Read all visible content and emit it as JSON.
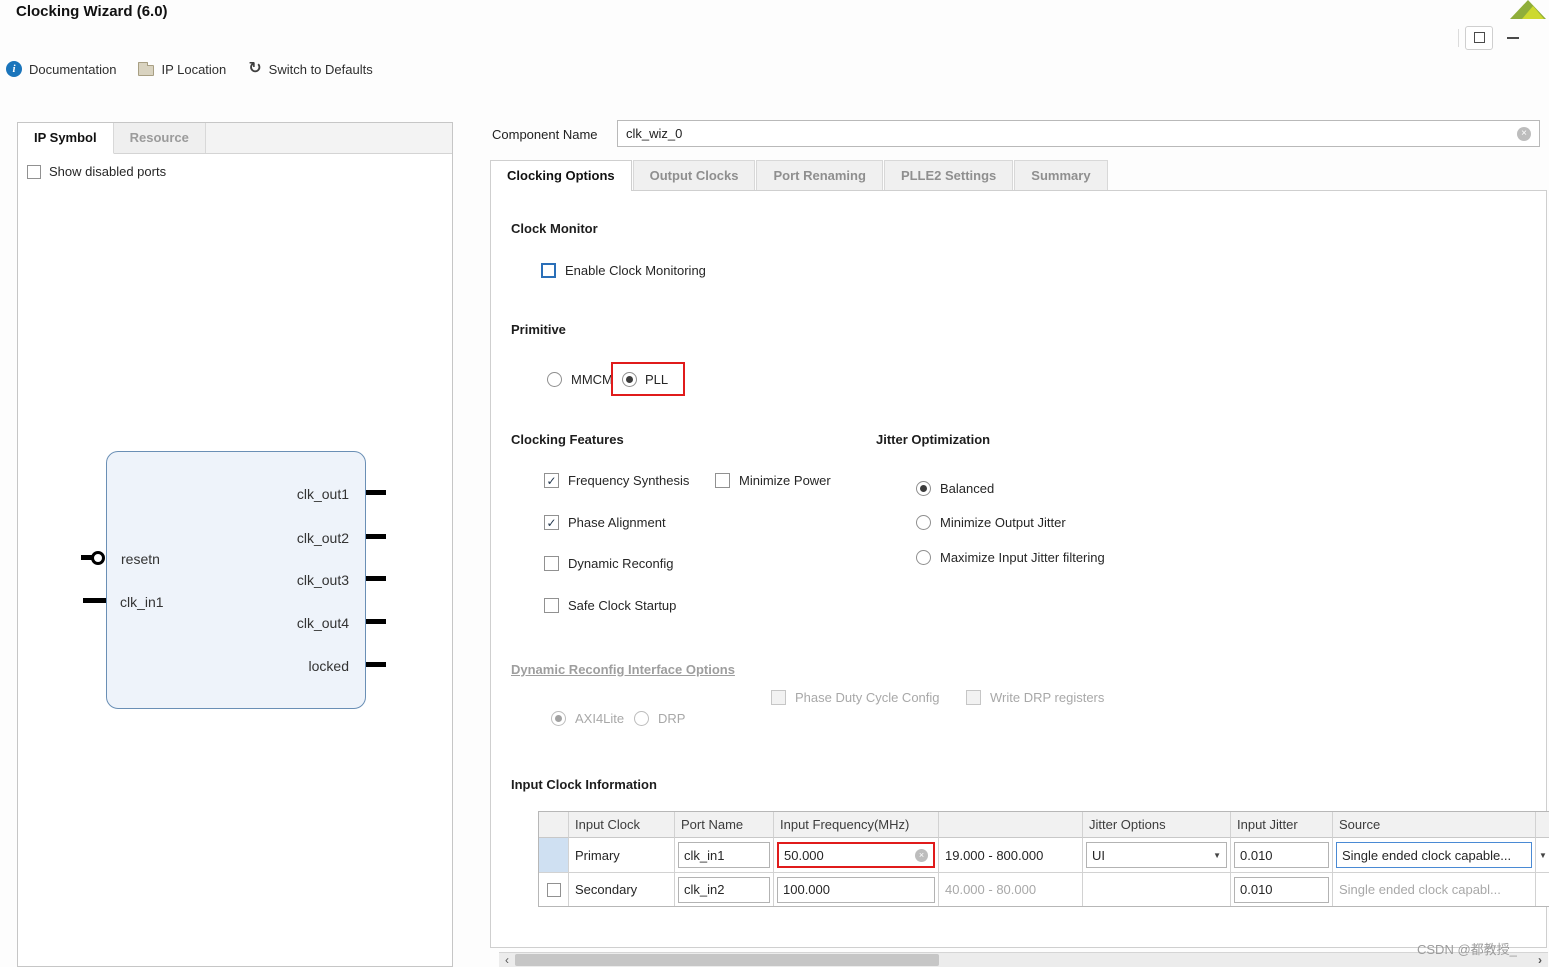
{
  "window": {
    "title": "Clocking Wizard (6.0)"
  },
  "toolbar": {
    "documentation": "Documentation",
    "ip_location": "IP Location",
    "switch_to_defaults": "Switch to Defaults"
  },
  "left_panel": {
    "tabs": [
      {
        "label": "IP Symbol",
        "active": true
      },
      {
        "label": "Resource",
        "active": false
      }
    ],
    "show_disabled_ports_label": "Show disabled ports",
    "show_disabled_ports_checked": false,
    "symbol": {
      "left_ports": [
        "resetn",
        "clk_in1"
      ],
      "right_ports": [
        "clk_out1",
        "clk_out2",
        "clk_out3",
        "clk_out4",
        "locked"
      ]
    }
  },
  "component": {
    "label": "Component Name",
    "value": "clk_wiz_0"
  },
  "tabs": [
    {
      "label": "Clocking Options",
      "active": true
    },
    {
      "label": "Output Clocks",
      "active": false
    },
    {
      "label": "Port Renaming",
      "active": false
    },
    {
      "label": "PLLE2 Settings",
      "active": false
    },
    {
      "label": "Summary",
      "active": false
    }
  ],
  "clock_monitor": {
    "title": "Clock Monitor",
    "enable_label": "Enable Clock Monitoring",
    "enabled": false
  },
  "primitive": {
    "title": "Primitive",
    "options": [
      {
        "label": "MMCM",
        "selected": false
      },
      {
        "label": "PLL",
        "selected": true,
        "highlighted": true
      }
    ]
  },
  "clocking_features": {
    "title": "Clocking Features",
    "options": [
      {
        "label": "Frequency Synthesis",
        "checked": true
      },
      {
        "label": "Minimize Power",
        "checked": false
      },
      {
        "label": "Phase Alignment",
        "checked": true
      },
      {
        "label": "Dynamic Reconfig",
        "checked": false
      },
      {
        "label": "Safe Clock Startup",
        "checked": false
      }
    ]
  },
  "jitter_optimization": {
    "title": "Jitter Optimization",
    "options": [
      {
        "label": "Balanced",
        "selected": true
      },
      {
        "label": "Minimize Output Jitter",
        "selected": false
      },
      {
        "label": "Maximize Input Jitter filtering",
        "selected": false
      }
    ]
  },
  "dynamic_reconfig_options": {
    "title": "Dynamic Reconfig Interface Options",
    "radios": [
      {
        "label": "AXI4Lite",
        "selected": true
      },
      {
        "label": "DRP",
        "selected": false
      }
    ],
    "checkboxes": [
      {
        "label": "Phase Duty Cycle Config",
        "checked": false
      },
      {
        "label": "Write DRP registers",
        "checked": false
      }
    ]
  },
  "input_clock_info": {
    "title": "Input Clock Information",
    "headers": {
      "input_clock": "Input Clock",
      "port_name": "Port Name",
      "input_frequency": "Input Frequency(MHz)",
      "jitter_options": "Jitter Options",
      "input_jitter": "Input Jitter",
      "source": "Source"
    },
    "rows": [
      {
        "input_clock": "Primary",
        "port_name": "clk_in1",
        "frequency": "50.000",
        "range": "19.000 - 800.000",
        "jitter_options": "UI",
        "input_jitter": "0.010",
        "source": "Single ended clock capable...",
        "enabled": true
      },
      {
        "input_clock": "Secondary",
        "port_name": "clk_in2",
        "frequency": "100.000",
        "range": "40.000 - 80.000",
        "jitter_options": "",
        "input_jitter": "0.010",
        "source": "Single ended clock capabl...",
        "enabled": false
      }
    ]
  },
  "colors": {
    "highlight_red": "#e01b1b",
    "accent_blue": "#2a6fb8",
    "selected_row_blue": "#cfe0f2",
    "logo_green": "#8fae3a"
  },
  "watermark": "CSDN @都教授_"
}
